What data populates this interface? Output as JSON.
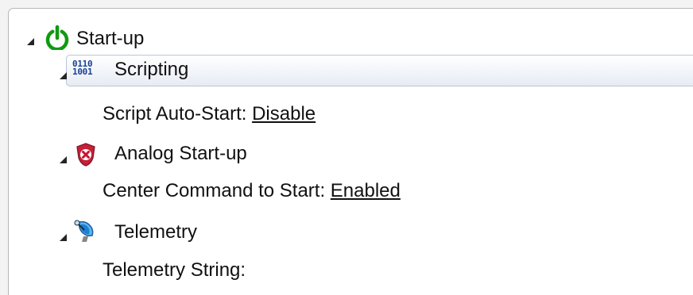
{
  "tree": {
    "root": {
      "label": "Start-up",
      "icon": "power-icon",
      "accent": "#0f9a11"
    },
    "scripting": {
      "label": "Scripting",
      "icon": "binary-code-icon",
      "icon_text": [
        "0110",
        "1001"
      ],
      "selected": true,
      "property": {
        "label": "Script Auto-Start:",
        "value": "Disable"
      }
    },
    "analog_startup": {
      "label": "Analog Start-up",
      "icon": "shield-error-icon",
      "property": {
        "label": "Center Command to Start:",
        "value": "Enabled"
      }
    },
    "telemetry": {
      "label": "Telemetry",
      "icon": "satellite-dish-icon",
      "property": {
        "label": "Telemetry String:",
        "value": ""
      }
    }
  }
}
